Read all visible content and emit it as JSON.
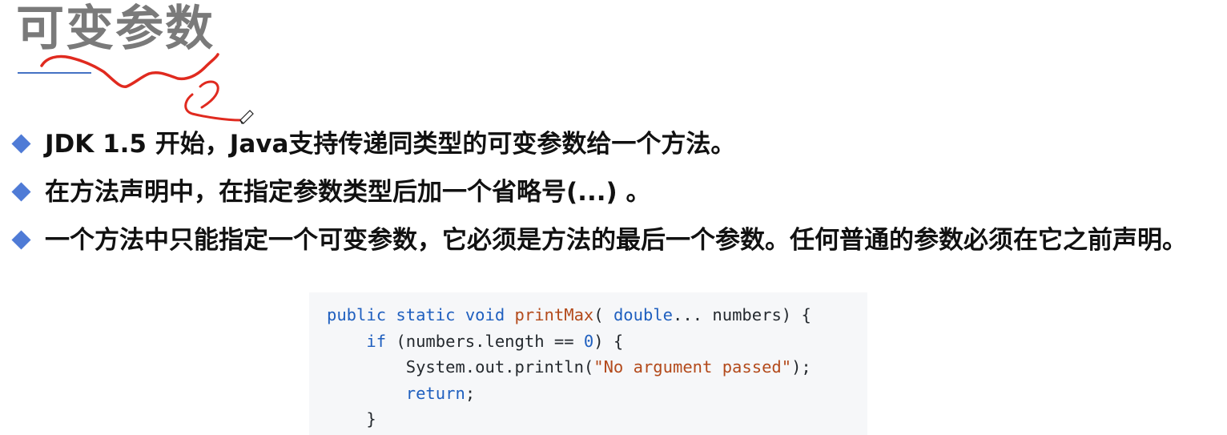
{
  "slide": {
    "title": "可变参数",
    "accent_color": "#4f7bd6",
    "annotation_color": "#e02a1f"
  },
  "bullets": [
    "JDK 1.5 开始，Java支持传递同类型的可变参数给一个方法。",
    "在方法声明中，在指定参数类型后加一个省略号(...) 。",
    "一个方法中只能指定一个可变参数，它必须是方法的最后一个参数。任何普通的参数必须在它之前声明。"
  ],
  "code": {
    "line1": {
      "kw1": "public",
      "kw2": "static",
      "kw3": "void",
      "fn": "printMax",
      "open": "(",
      "type": "double",
      "rest": "... numbers) {"
    },
    "line2": {
      "kw": "if",
      "pre": " (numbers.length == ",
      "num": "0",
      "post": ") {"
    },
    "line3": {
      "pre": "System.out.println(",
      "str": "\"No argument passed\"",
      "post": ");"
    },
    "line4": {
      "kw": "return",
      "post": ";"
    },
    "line5": {
      "text": "}"
    }
  }
}
